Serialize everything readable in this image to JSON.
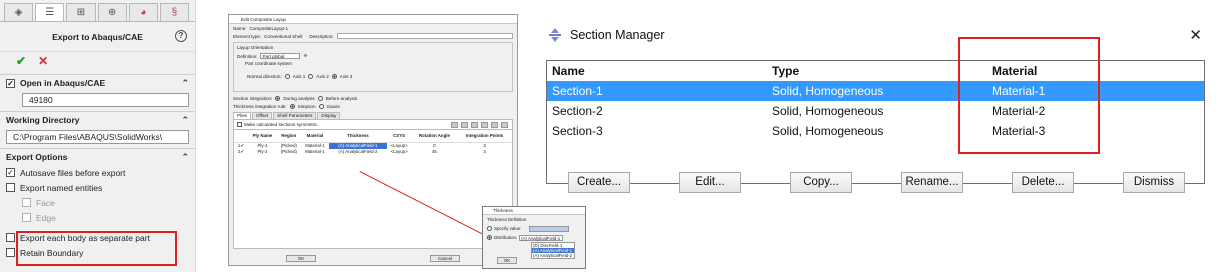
{
  "property_manager": {
    "tabs": [
      "cube",
      "list",
      "config",
      "target",
      "appearance",
      "abaqus"
    ],
    "title": "Export to Abaqus/CAE",
    "help": "?",
    "ok": "✔",
    "cancel": "✕",
    "open_group": {
      "checkbox_label": "Open in Abaqus/CAE",
      "checked": true,
      "value": "49180"
    },
    "working_dir": {
      "title": "Working Directory",
      "value": "C:\\Program Files\\ABAQUS\\SolidWorks\\"
    },
    "export_options": {
      "title": "Export Options",
      "items": [
        {
          "label": "Autosave files before export",
          "checked": true,
          "enabled": true,
          "indent": false
        },
        {
          "label": "Export named entities",
          "checked": false,
          "enabled": true,
          "indent": false
        },
        {
          "label": "Face",
          "checked": false,
          "enabled": false,
          "indent": true
        },
        {
          "label": "Edge",
          "checked": false,
          "enabled": false,
          "indent": true
        },
        {
          "label": "Export each body as separate part",
          "checked": false,
          "enabled": true,
          "indent": false
        },
        {
          "label": "Retain Boundary",
          "checked": false,
          "enabled": true,
          "indent": false
        }
      ]
    }
  },
  "composite_layup": {
    "title": "Edit Composite Layup",
    "name_label": "Name:",
    "name_value": "CompositeLayup-1",
    "element_type_label": "Element type:",
    "element_type_value": "Conventional Shell",
    "description_label": "Description:",
    "orientation_title": "Layup Orientation",
    "definition_label": "Definition:",
    "definition_value": "Part global",
    "part_coord": "Part coordinate system",
    "normal_label": "Normal direction:",
    "normal_options": [
      "Axis 1",
      "Axis 2",
      "Axis 3"
    ],
    "section_integration_label": "Section integration:",
    "section_integration_options": [
      "During analysis",
      "Before analysis"
    ],
    "thickness_rule_label": "Thickness integration rule:",
    "thickness_rule_options": [
      "Simpson",
      "Gauss"
    ],
    "tabs": [
      "Plies",
      "Offset",
      "Shell Parameters",
      "Display"
    ],
    "symmetric_label": "Make calculated sections symmetric",
    "columns": [
      "Ply Name",
      "Region",
      "Material",
      "Thickness",
      "CSYS",
      "Rotation Angle",
      "Integration Points"
    ],
    "rows": [
      {
        "num": "1",
        "check": "✔",
        "ply": "Ply-1",
        "region": "(Picked)",
        "material": "Material-1",
        "thickness": "(A) AnalyticalField-1",
        "csys": "<Layup>",
        "angle": "0",
        "points": "3"
      },
      {
        "num": "2",
        "check": "✔",
        "ply": "Ply-2",
        "region": "(Picked)",
        "material": "Material-1",
        "thickness": "(A) AnalyticalField-2",
        "csys": "<Layup>",
        "angle": "45",
        "points": "3"
      }
    ],
    "ok": "OK",
    "cancel": "Cancel"
  },
  "thickness_dialog": {
    "title": "Thickness",
    "group_label": "Thickness Definition",
    "specify_label": "Specify value:",
    "distribution_label": "Distribution:",
    "distribution_value": "(A) AnalyticalField-1",
    "options": [
      "(D) DiscField-1",
      "(A) AnalyticalField-1",
      "(A) AnalyticalField-2"
    ],
    "selected_index": 1,
    "ok": "OK"
  },
  "section_manager": {
    "title": "Section Manager",
    "close": "✕",
    "columns": [
      "Name",
      "Type",
      "Material"
    ],
    "rows": [
      {
        "name": "Section-1",
        "type": "Solid, Homogeneous",
        "material": "Material-1",
        "selected": true
      },
      {
        "name": "Section-2",
        "type": "Solid, Homogeneous",
        "material": "Material-2",
        "selected": false
      },
      {
        "name": "Section-3",
        "type": "Solid, Homogeneous",
        "material": "Material-3",
        "selected": false
      }
    ],
    "buttons": [
      "Create...",
      "Edit...",
      "Copy...",
      "Rename...",
      "Delete...",
      "Dismiss"
    ]
  },
  "colors": {
    "highlight": "#e02020",
    "selection": "#3399ff",
    "check_green": "#2a9d2a"
  }
}
